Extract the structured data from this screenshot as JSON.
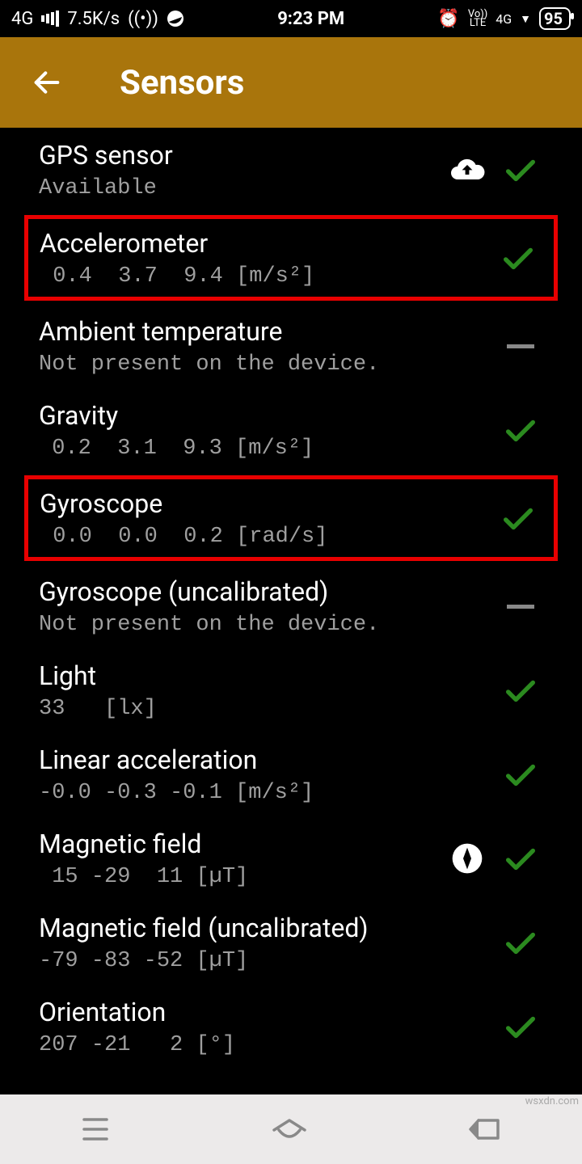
{
  "statusbar": {
    "net": "4G",
    "speed": "7.5K/s",
    "time": "9:23 PM",
    "volte": "Vo))\nLTE",
    "net2": "4G",
    "battery": "95"
  },
  "appbar": {
    "title": "Sensors"
  },
  "sensors": [
    {
      "name": "gps",
      "title": "GPS sensor",
      "sub": "Available",
      "icon": "cloud",
      "status": "check",
      "hl": false
    },
    {
      "name": "accel",
      "title": "Accelerometer",
      "sub": " 0.4  3.7  9.4 [m/s²]",
      "icon": "",
      "status": "check",
      "hl": true
    },
    {
      "name": "ambient",
      "title": "Ambient temperature",
      "sub": "Not present on the device.",
      "icon": "",
      "status": "dash",
      "hl": false
    },
    {
      "name": "gravity",
      "title": "Gravity",
      "sub": " 0.2  3.1  9.3 [m/s²]",
      "icon": "",
      "status": "check",
      "hl": false
    },
    {
      "name": "gyro",
      "title": "Gyroscope",
      "sub": " 0.0  0.0  0.2 [rad/s]",
      "icon": "",
      "status": "check",
      "hl": true
    },
    {
      "name": "gyro-uncal",
      "title": "Gyroscope (uncalibrated)",
      "sub": "Not present on the device.",
      "icon": "",
      "status": "dash",
      "hl": false
    },
    {
      "name": "light",
      "title": "Light",
      "sub": "33   [lx]",
      "icon": "",
      "status": "check",
      "hl": false
    },
    {
      "name": "linaccel",
      "title": "Linear acceleration",
      "sub": "-0.0 -0.3 -0.1 [m/s²]",
      "icon": "",
      "status": "check",
      "hl": false
    },
    {
      "name": "magfield",
      "title": "Magnetic field",
      "sub": " 15 -29  11 [µT]",
      "icon": "compass",
      "status": "check",
      "hl": false
    },
    {
      "name": "magfield-uncal",
      "title": "Magnetic field (uncalibrated)",
      "sub": "-79 -83 -52 [µT]",
      "icon": "",
      "status": "check",
      "hl": false
    },
    {
      "name": "orientation",
      "title": "Orientation",
      "sub": "207 -21   2 [°]",
      "icon": "",
      "status": "check",
      "hl": false
    }
  ],
  "watermark": "wsxdn.com"
}
